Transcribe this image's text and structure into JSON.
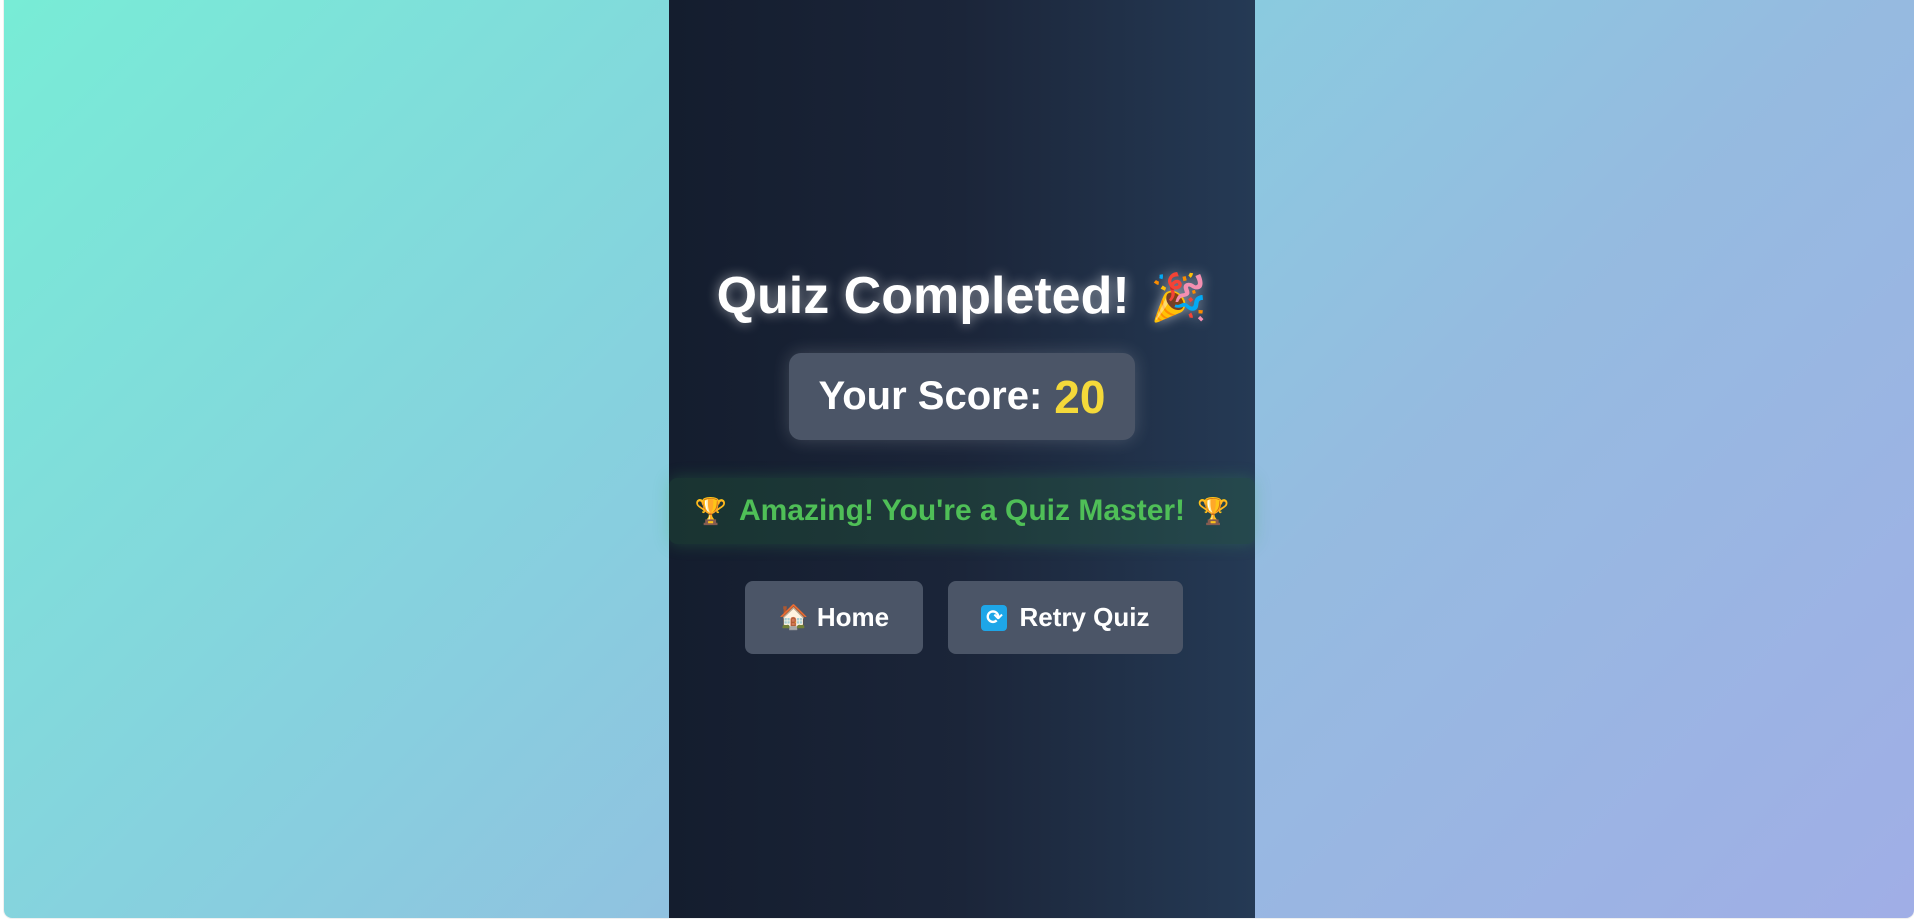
{
  "result": {
    "title": "Quiz Completed!",
    "title_emoji": "🎉",
    "score_label": "Your Score:",
    "score_value": "20",
    "message": "Amazing! You're a Quiz Master!",
    "trophy_left": "🏆",
    "trophy_right": "🏆"
  },
  "buttons": {
    "home_icon": "🏠",
    "home_label": "Home",
    "retry_icon": "🔄",
    "retry_label": "Retry Quiz"
  },
  "colors": {
    "score_accent": "#f4d93a",
    "message_green": "#4fbf57",
    "panel_dark": "#1b2539",
    "button_bg": "#4b5567"
  }
}
